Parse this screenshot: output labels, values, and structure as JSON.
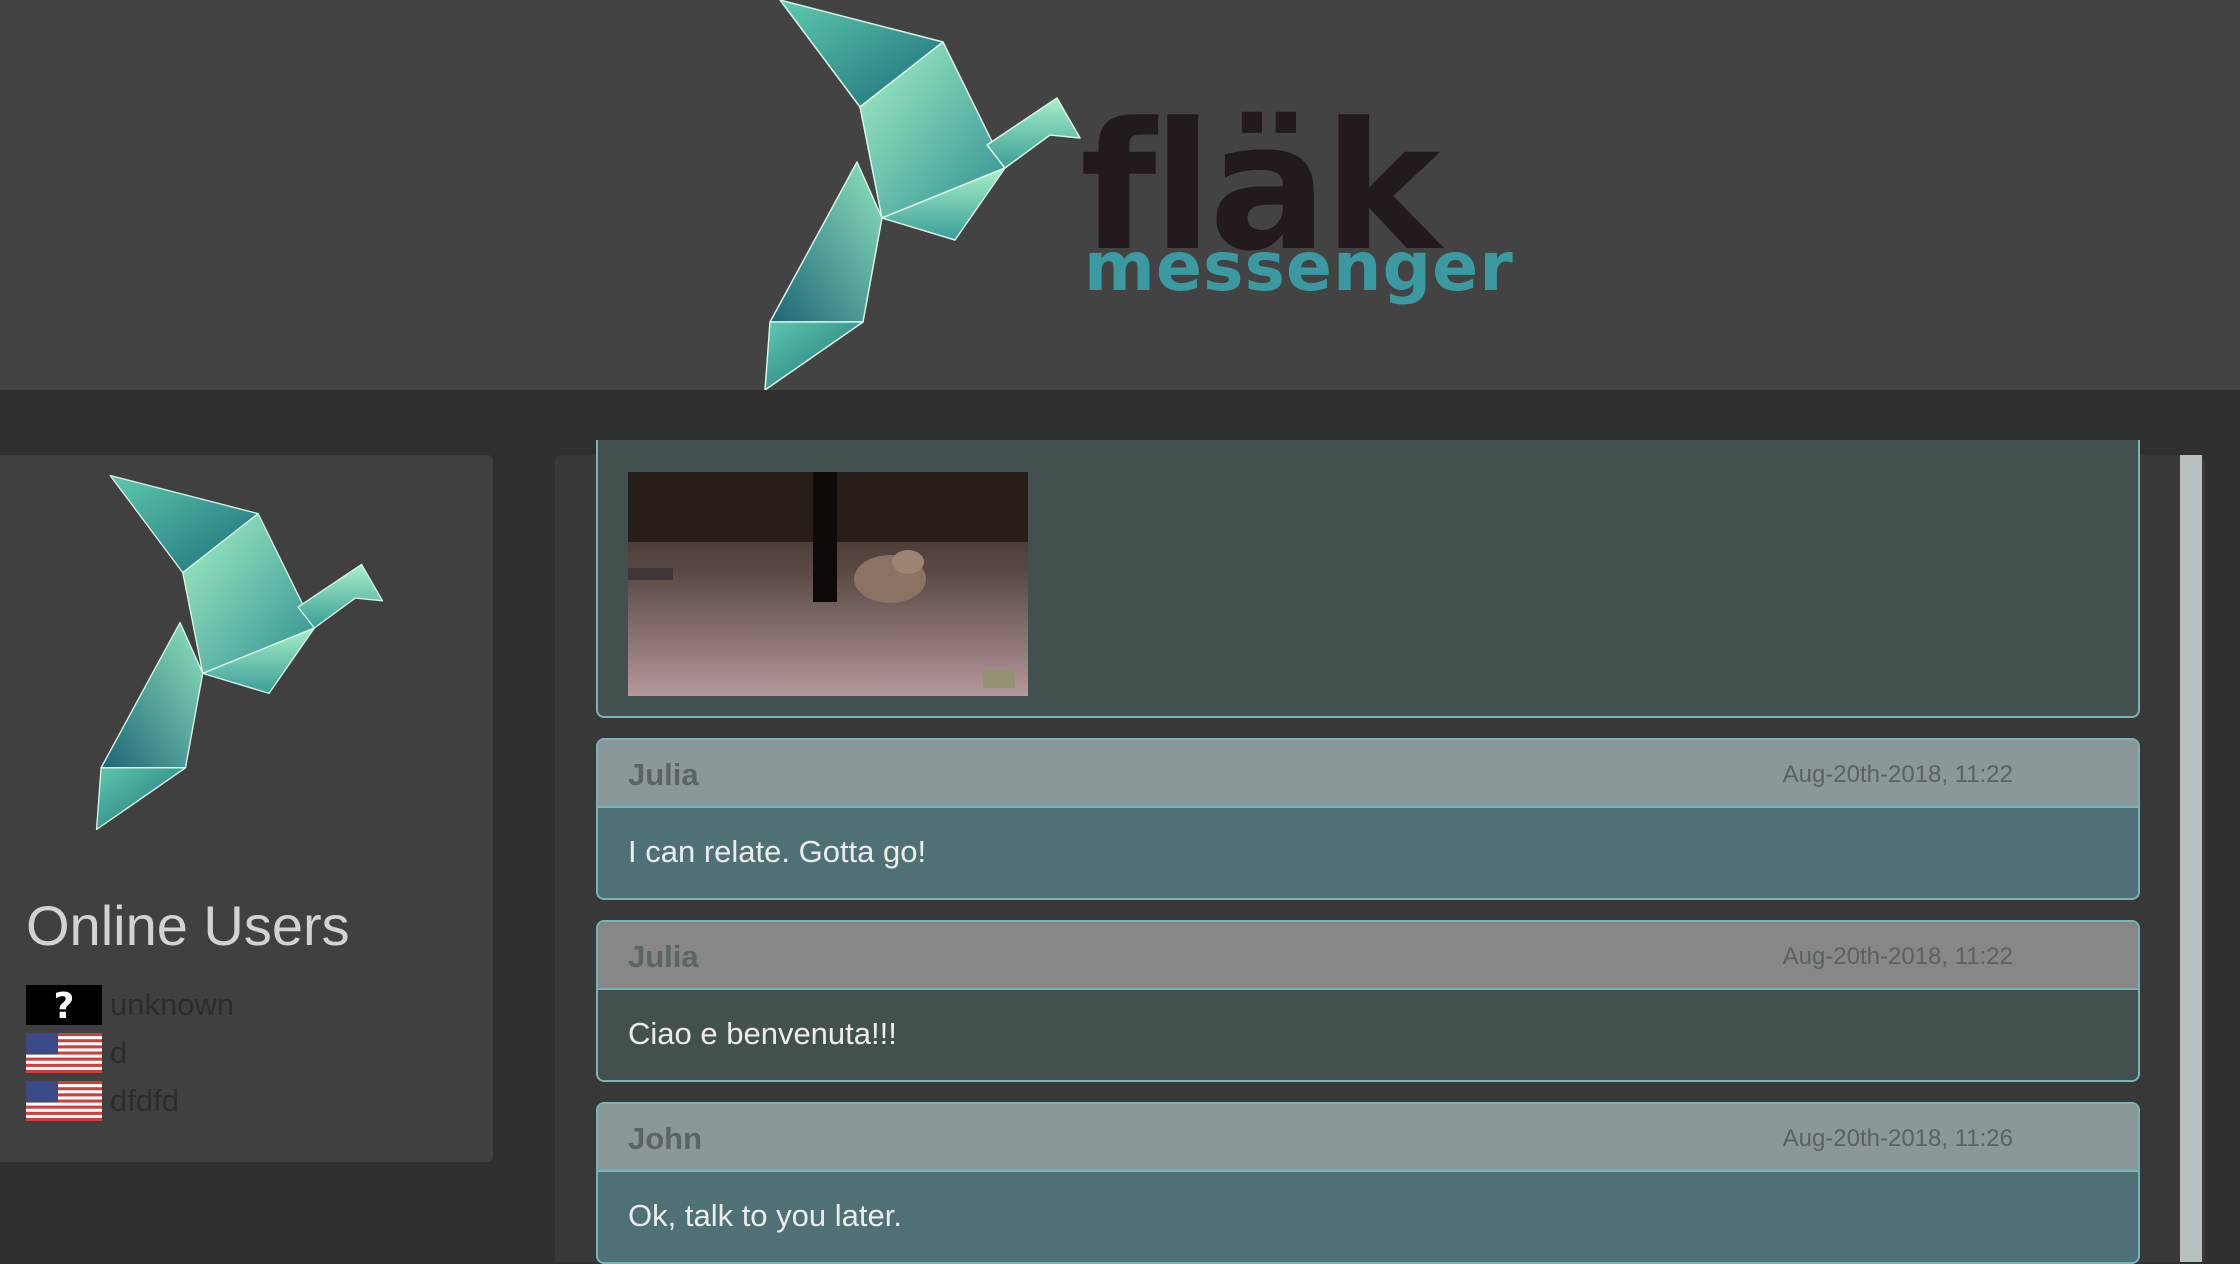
{
  "brand": {
    "name": "fläk",
    "tagline": "messenger",
    "primary_color": "#231a1d",
    "accent_color": "#3b9aa1",
    "logo_icon": "origami-bird-icon"
  },
  "sidebar": {
    "title": "Online Users",
    "users": [
      {
        "name": "unknown",
        "flag": "unknown-flag-icon"
      },
      {
        "name": "d",
        "flag": "us-flag-icon"
      },
      {
        "name": "dfdfd",
        "flag": "us-flag-icon"
      }
    ]
  },
  "messages": [
    {
      "type": "image",
      "image": "animated-gif-thumbnail"
    },
    {
      "author": "Julia",
      "time": "Aug-20th-2018, 11:22",
      "text": "I can relate. Gotta go!",
      "head_color": "#8a9899",
      "body_color": "#4f7074"
    },
    {
      "author": "Julia",
      "time": "Aug-20th-2018, 11:22",
      "text": "Ciao e benvenuta!!!",
      "head_color": "#878787",
      "body_color": "#425050"
    },
    {
      "author": "John",
      "time": "Aug-20th-2018, 11:26",
      "text": "Ok, talk to you later.",
      "head_color": "#8a9899",
      "body_color": "#4f7074"
    }
  ]
}
